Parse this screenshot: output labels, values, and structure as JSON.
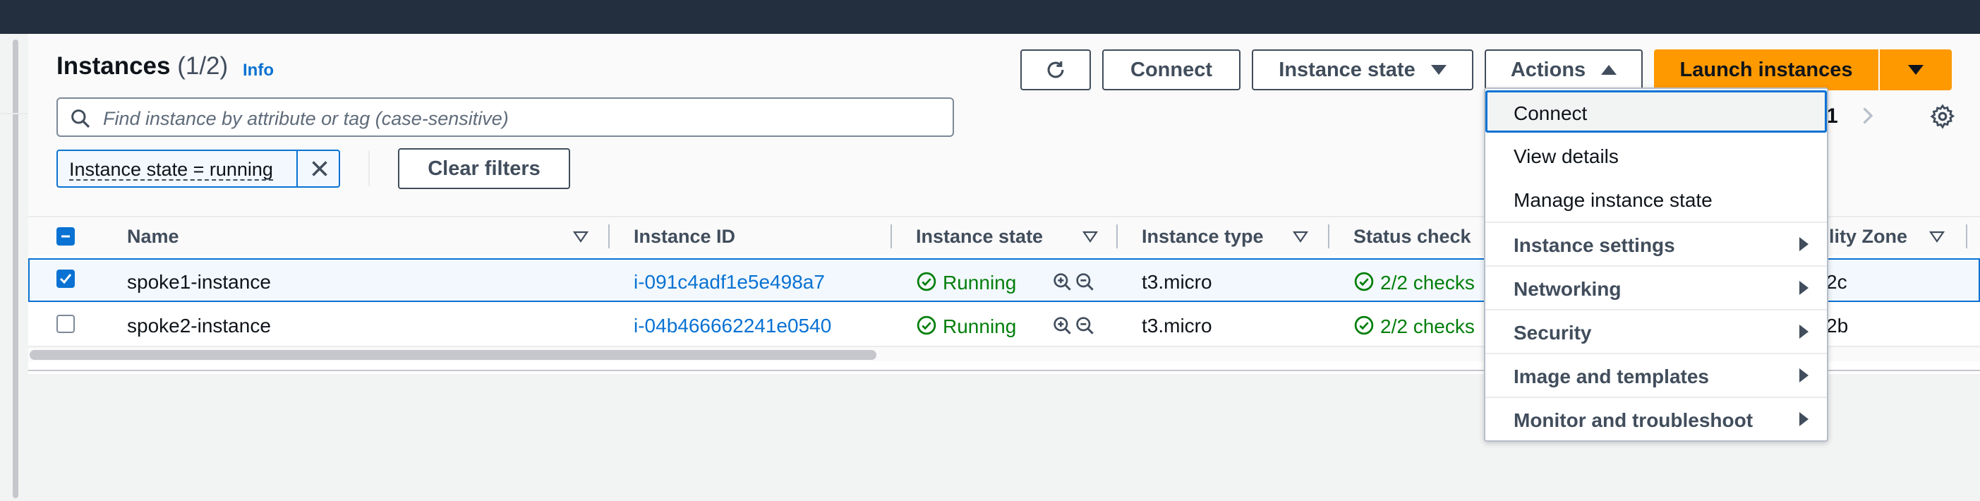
{
  "header": {
    "title": "Instances",
    "count": "(1/2)",
    "info": "Info"
  },
  "toolbar": {
    "refresh_icon": "refresh-icon",
    "connect_label": "Connect",
    "instance_state_label": "Instance state",
    "actions_label": "Actions",
    "launch_label": "Launch instances"
  },
  "search": {
    "placeholder": "Find instance by attribute or tag (case-sensitive)"
  },
  "filters": {
    "token": "Instance state = running",
    "clear_label": "Clear filters"
  },
  "pagination": {
    "current_page": "1"
  },
  "table": {
    "headers": {
      "name": "Name",
      "instance_id": "Instance ID",
      "instance_state": "Instance state",
      "instance_type": "Instance type",
      "status_check": "Status check",
      "availability_zone": "lity Zone"
    },
    "rows": [
      {
        "selected": true,
        "name": "spoke1-instance",
        "instance_id": "i-091c4adf1e5e498a7",
        "state": "Running",
        "type": "t3.micro",
        "status": "2/2 checks",
        "zone": "2c"
      },
      {
        "selected": false,
        "name": "spoke2-instance",
        "instance_id": "i-04b466662241e0540",
        "state": "Running",
        "type": "t3.micro",
        "status": "2/2 checks",
        "zone": "2b"
      }
    ]
  },
  "actions_menu": {
    "items": [
      {
        "label": "Connect"
      },
      {
        "label": "View details"
      },
      {
        "label": "Manage instance state"
      },
      {
        "label": "Instance settings"
      },
      {
        "label": "Networking"
      },
      {
        "label": "Security"
      },
      {
        "label": "Image and templates"
      },
      {
        "label": "Monitor and troubleshoot"
      }
    ]
  },
  "colors": {
    "topbar": "#232f3e",
    "link": "#0972d3",
    "success": "#037f0c",
    "primary_button": "#ff9900"
  }
}
